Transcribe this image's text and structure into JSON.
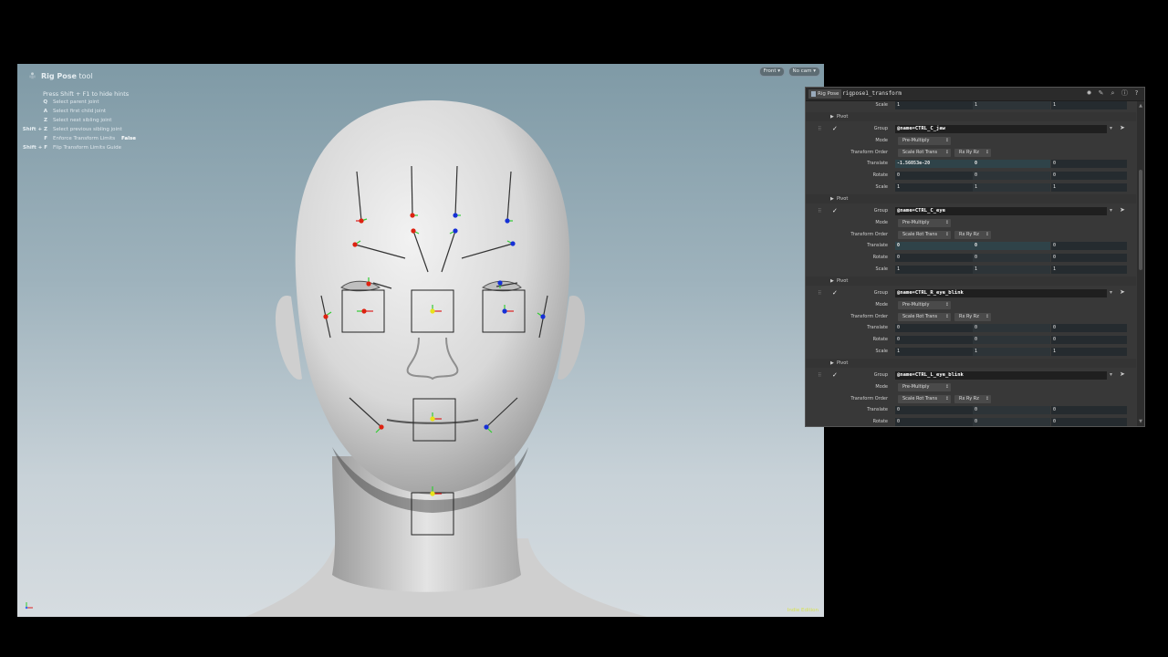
{
  "viewport": {
    "title_bold": "Rig Pose",
    "title_rest": " tool",
    "hint_press": "Press Shift + F1 to hide hints",
    "shortcuts": [
      {
        "key": "Q",
        "desc": "Select parent joint",
        "value": ""
      },
      {
        "key": "A",
        "desc": "Select first child joint",
        "value": ""
      },
      {
        "key": "Z",
        "desc": "Select next sibling joint",
        "value": ""
      },
      {
        "key": "Shift + Z",
        "desc": "Select previous sibling joint",
        "value": ""
      },
      {
        "key": "F",
        "desc": "Enforce Transform Limits",
        "value": "False"
      },
      {
        "key": "Shift + F",
        "desc": "Flip Transform Limits Guide",
        "value": ""
      }
    ],
    "view_button": "Front",
    "cam_button": "No cam",
    "edition": "Indie Edition"
  },
  "panel": {
    "node_type": "Rig Pose",
    "node_name": "rigpose1_transform",
    "labels": {
      "scale": "Scale",
      "pivot": "Pivot",
      "group": "Group",
      "mode": "Mode",
      "transform_order": "Transform Order",
      "translate": "Translate",
      "rotate": "Rotate"
    },
    "top_scale": [
      "1",
      "1",
      "1"
    ],
    "groups": [
      {
        "group": "@name=CTRL_C_jaw",
        "mode": "Pre-Multiply",
        "order": "Scale Rot Trans",
        "rot_order": "Rx Ry Rz",
        "translate": [
          "-1.56053e-20",
          "0",
          "0"
        ],
        "rotate": [
          "0",
          "0",
          "0"
        ],
        "scale": [
          "1",
          "1",
          "1"
        ]
      },
      {
        "group": "@name=CTRL_C_eye",
        "mode": "Pre-Multiply",
        "order": "Scale Rot Trans",
        "rot_order": "Rx Ry Rz",
        "translate": [
          "0",
          "0",
          "0"
        ],
        "rotate": [
          "0",
          "0",
          "0"
        ],
        "scale": [
          "1",
          "1",
          "1"
        ]
      },
      {
        "group": "@name=CTRL_R_eye_blink",
        "mode": "Pre-Multiply",
        "order": "Scale Rot Trans",
        "rot_order": "Rx Ry Rz",
        "translate": [
          "0",
          "0",
          "0"
        ],
        "rotate": [
          "0",
          "0",
          "0"
        ],
        "scale": [
          "1",
          "1",
          "1"
        ]
      },
      {
        "group": "@name=CTRL_L_eye_blink",
        "mode": "Pre-Multiply",
        "order": "Scale Rot Trans",
        "rot_order": "Rx Ry Rz",
        "translate": [
          "0",
          "0",
          "0"
        ],
        "rotate": [
          "0",
          "0",
          "0"
        ]
      }
    ]
  }
}
